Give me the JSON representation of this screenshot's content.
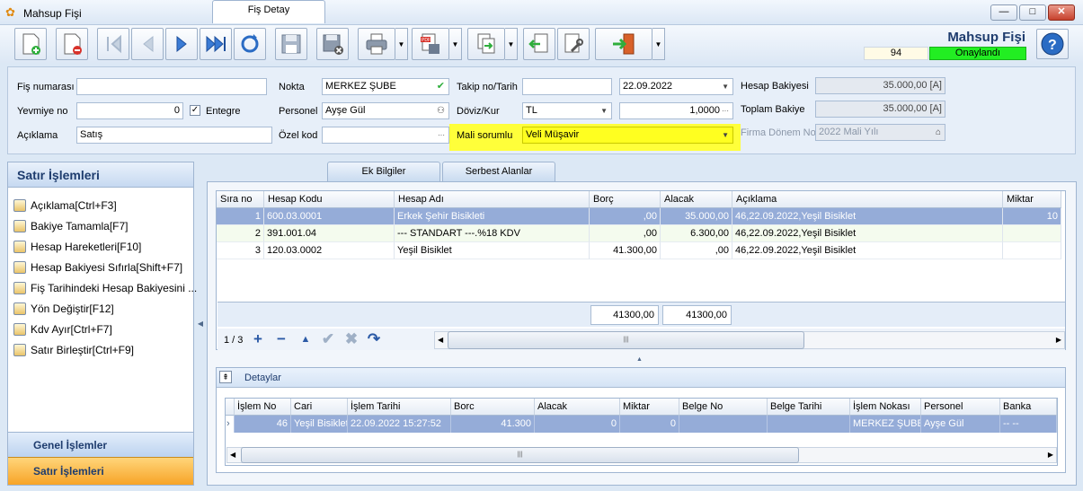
{
  "window": {
    "title": "Mahsup Fişi",
    "minimize_label": "—",
    "maximize_label": "□",
    "close_label": "✕"
  },
  "header": {
    "title": "Mahsup Fişi",
    "number": "94",
    "status": "Onaylandı",
    "status_color": "#22ee22"
  },
  "toolbar": {
    "dropdown_glyph": "▼"
  },
  "form": {
    "fis_numarasi_label": "Fiş numarası",
    "fis_numarasi": "",
    "yevmiye_label": "Yevmiye no",
    "yevmiye": "0",
    "entegre_label": "Entegre",
    "entegre_checked": true,
    "aciklama_label": "Açıklama",
    "aciklama": "Satış",
    "nokta_label": "Nokta",
    "nokta": "MERKEZ ŞUBE",
    "personel_label": "Personel",
    "personel": "Ayşe Gül",
    "ozel_kod_label": "Özel kod",
    "ozel_kod": "",
    "takip_label": "Takip no/Tarih",
    "takip": "",
    "tarih": "22.09.2022",
    "doviz_label": "Döviz/Kur",
    "doviz": "TL",
    "kur": "1,0000",
    "mali_label": "Mali sorumlu",
    "mali": "Veli Müşavir",
    "hesap_bakiyesi_label": "Hesap Bakiyesi",
    "hesap_bakiyesi": "35.000,00 [A]",
    "toplam_bakiye_label": "Toplam Bakiye",
    "toplam_bakiye": "35.000,00 [A]",
    "firma_donem_label": "Firma Dönem No",
    "firma_donem": "2022 Mali Yılı",
    "highlight_color": "#ffff3a"
  },
  "left_panel": {
    "title": "Satır İşlemleri",
    "items": [
      {
        "label": "Açıklama[Ctrl+F3]"
      },
      {
        "label": "Bakiye Tamamla[F7]"
      },
      {
        "label": "Hesap Hareketleri[F10]"
      },
      {
        "label": "Hesap Bakiyesi Sıfırla[Shift+F7]"
      },
      {
        "label": "Fiş Tarihindeki Hesap Bakiyesini ..."
      },
      {
        "label": "Yön Değiştir[F12]"
      },
      {
        "label": "Kdv Ayır[Ctrl+F7]"
      },
      {
        "label": "Satır Birleştir[Ctrl+F9]"
      }
    ],
    "genel": "Genel İşlemler",
    "satir": "Satır İşlemleri"
  },
  "tabs": [
    "Fiş Detay",
    "Ek Bilgiler",
    "Serbest Alanlar"
  ],
  "grid": {
    "columns": [
      "Sıra no",
      "Hesap Kodu",
      "Hesap Adı",
      "Borç",
      "Alacak",
      "Açıklama",
      "Miktar"
    ],
    "rows": [
      {
        "sira": "1",
        "kod": "600.03.0001",
        "ad": "Erkek Şehir Bisikleti",
        "borc": ",00",
        "alacak": "35.000,00",
        "aciklama": "46,22.09.2022,Yeşil Bisiklet",
        "miktar": "10"
      },
      {
        "sira": "2",
        "kod": "391.001.04",
        "ad": "--- STANDART ---.%18 KDV",
        "borc": ",00",
        "alacak": "6.300,00",
        "aciklama": "46,22.09.2022,Yeşil Bisiklet",
        "miktar": ""
      },
      {
        "sira": "3",
        "kod": "120.03.0002",
        "ad": "Yeşil Bisiklet",
        "borc": "41.300,00",
        "alacak": ",00",
        "aciklama": "46,22.09.2022,Yeşil Bisiklet",
        "miktar": ""
      }
    ],
    "total_borc": "41300,00",
    "total_alacak": "41300,00",
    "page": "1 / 3"
  },
  "details": {
    "title": "Detaylar",
    "collapse_glyph": "⇞",
    "columns": [
      "İşlem No",
      "Cari",
      "İşlem Tarihi",
      "Borc",
      "Alacak",
      "Miktar",
      "Belge No",
      "Belge Tarihi",
      "İşlem Nokası",
      "Personel",
      "Banka"
    ],
    "row": {
      "islem_no": "46",
      "cari": "Yeşil Bisiklet",
      "islem_tarihi": "22.09.2022 15:27:52",
      "borc": "41.300",
      "alacak": "0",
      "miktar": "0",
      "belge_no": "",
      "belge_tarihi": "",
      "islem_noktasi": "MERKEZ ŞUBE",
      "personel": "Ayşe Gül",
      "banka": "-- --"
    }
  }
}
